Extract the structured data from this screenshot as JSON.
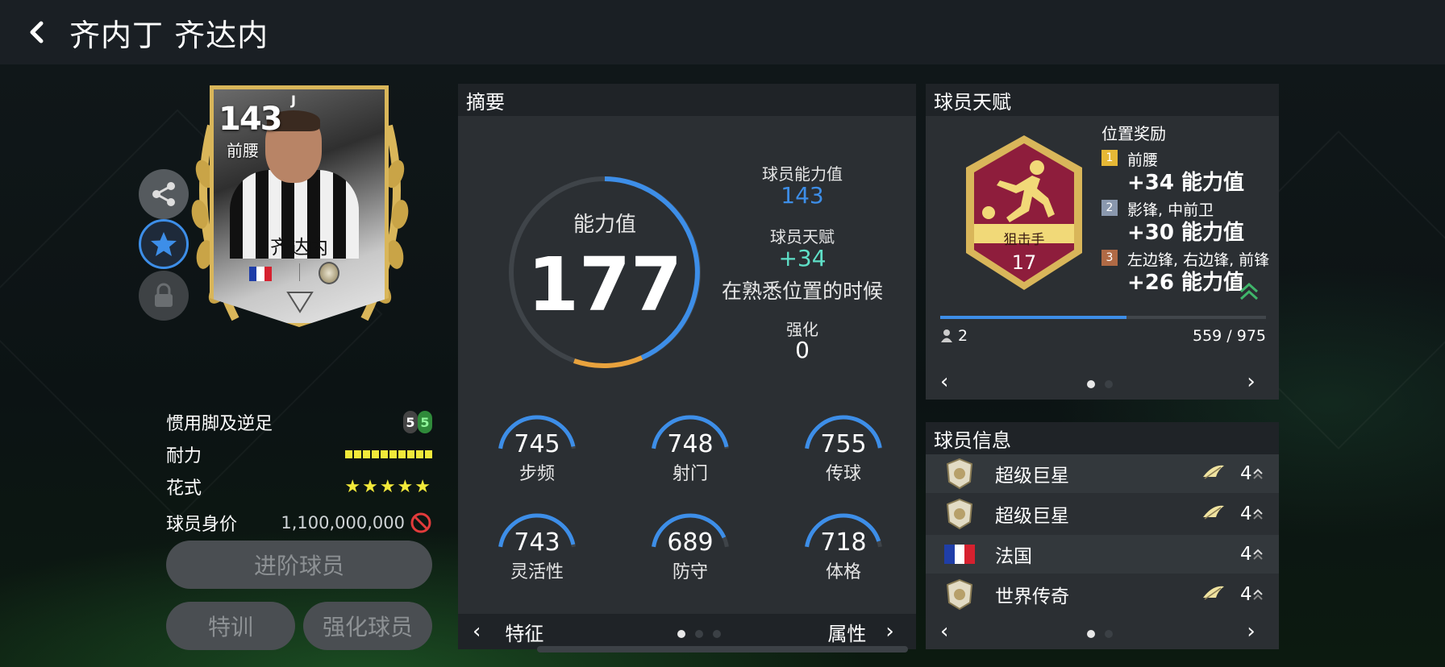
{
  "header": {
    "title": "齐内丁 齐达内",
    "back_icon": "chevron-left-icon"
  },
  "card": {
    "ovr": "143",
    "position": "前腰",
    "club_mark": "J",
    "name": "齐达内",
    "nation_flag_colors": [
      "#1f3ea8",
      "#ffffff",
      "#d6212f"
    ],
    "rarity_color": "#d9b65a"
  },
  "side_buttons": [
    {
      "name": "share",
      "icon": "share-icon"
    },
    {
      "name": "favorite",
      "icon": "star-icon",
      "state": "active"
    },
    {
      "name": "lock",
      "icon": "lock-icon",
      "state": "disabled"
    }
  ],
  "attributes": {
    "foot_label": "惯用脚及逆足",
    "foot_left": "5",
    "foot_right": "5",
    "stamina_label": "耐力",
    "stamina_level": 1.0,
    "skill_label": "花式",
    "skill_stars": "★★★★★",
    "price_label": "球员身价",
    "price_value": "1,100,000,000"
  },
  "buttons": {
    "advance": "进阶球员",
    "train": "特训",
    "enhance": "强化球员"
  },
  "summary": {
    "title": "摘要",
    "ring_label": "能力值",
    "ring_value": "177",
    "ability_label": "球员能力值",
    "ability_value": "143",
    "talent_label": "球员天赋",
    "talent_value": "+34",
    "talent_note": "在熟悉位置的时候",
    "enhance_label": "强化",
    "enhance_value": "0",
    "stats": [
      {
        "value": "745",
        "label": "步频"
      },
      {
        "value": "748",
        "label": "射门"
      },
      {
        "value": "755",
        "label": "传球"
      },
      {
        "value": "743",
        "label": "灵活性"
      },
      {
        "value": "689",
        "label": "防守"
      },
      {
        "value": "718",
        "label": "体格"
      }
    ],
    "pager_left": "特征",
    "pager_right": "属性",
    "accent_blue": "#3d8ee8",
    "accent_orange": "#e8a23d"
  },
  "talent": {
    "title": "球员天赋",
    "bonus_title": "位置奖励",
    "badge_name": "狙击手",
    "badge_level": "17",
    "bonuses": [
      {
        "num": "1",
        "positions": "前腰",
        "value": "+34 能力值",
        "color": "#e6b836"
      },
      {
        "num": "2",
        "positions": "影锋, 中前卫",
        "value": "+30 能力值",
        "color": "#8a98ae"
      },
      {
        "num": "3",
        "positions": "左边锋, 右边锋, 前锋",
        "value": "+26 能力值",
        "color": "#b06a45"
      }
    ],
    "level_count": "2",
    "progress_text": "559 / 975",
    "progress_fraction": 0.573
  },
  "info": {
    "title": "球员信息",
    "rows": [
      {
        "name": "超级巨星",
        "count": "4",
        "icon": "icon-badge-icon",
        "feather": true
      },
      {
        "name": "超级巨星",
        "count": "4",
        "icon": "icon-badge-icon",
        "feather": true
      },
      {
        "name": "法国",
        "count": "4",
        "icon": "france-flag-icon",
        "feather": false
      },
      {
        "name": "世界传奇",
        "count": "4",
        "icon": "icon-badge-icon",
        "feather": true
      }
    ]
  }
}
